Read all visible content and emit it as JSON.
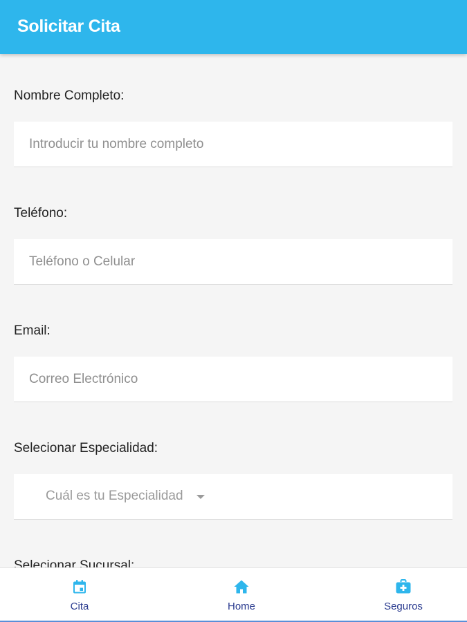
{
  "app_bar": {
    "title": "Solicitar Cita"
  },
  "form": {
    "nombre": {
      "label": "Nombre Completo:",
      "placeholder": "Introducir tu nombre completo"
    },
    "telefono": {
      "label": "Teléfono:",
      "placeholder": "Teléfono o Celular"
    },
    "email": {
      "label": "Email:",
      "placeholder": "Correo Electrónico"
    },
    "especialidad": {
      "label": "Selecionar Especialidad:",
      "placeholder": "Cuál es tu Especialidad"
    },
    "sucursal": {
      "label": "Selecionar Sucursal:"
    }
  },
  "tabs": [
    {
      "label": "Cita",
      "icon": "calendar-icon"
    },
    {
      "label": "Home",
      "icon": "home-icon"
    },
    {
      "label": "Seguros",
      "icon": "medical-kit-icon"
    }
  ],
  "colors": {
    "app_bar": "#2eb6ec",
    "tab_icon": "#2eb6ec",
    "tab_label": "#2a3b8f",
    "background": "#f5f5f5"
  }
}
